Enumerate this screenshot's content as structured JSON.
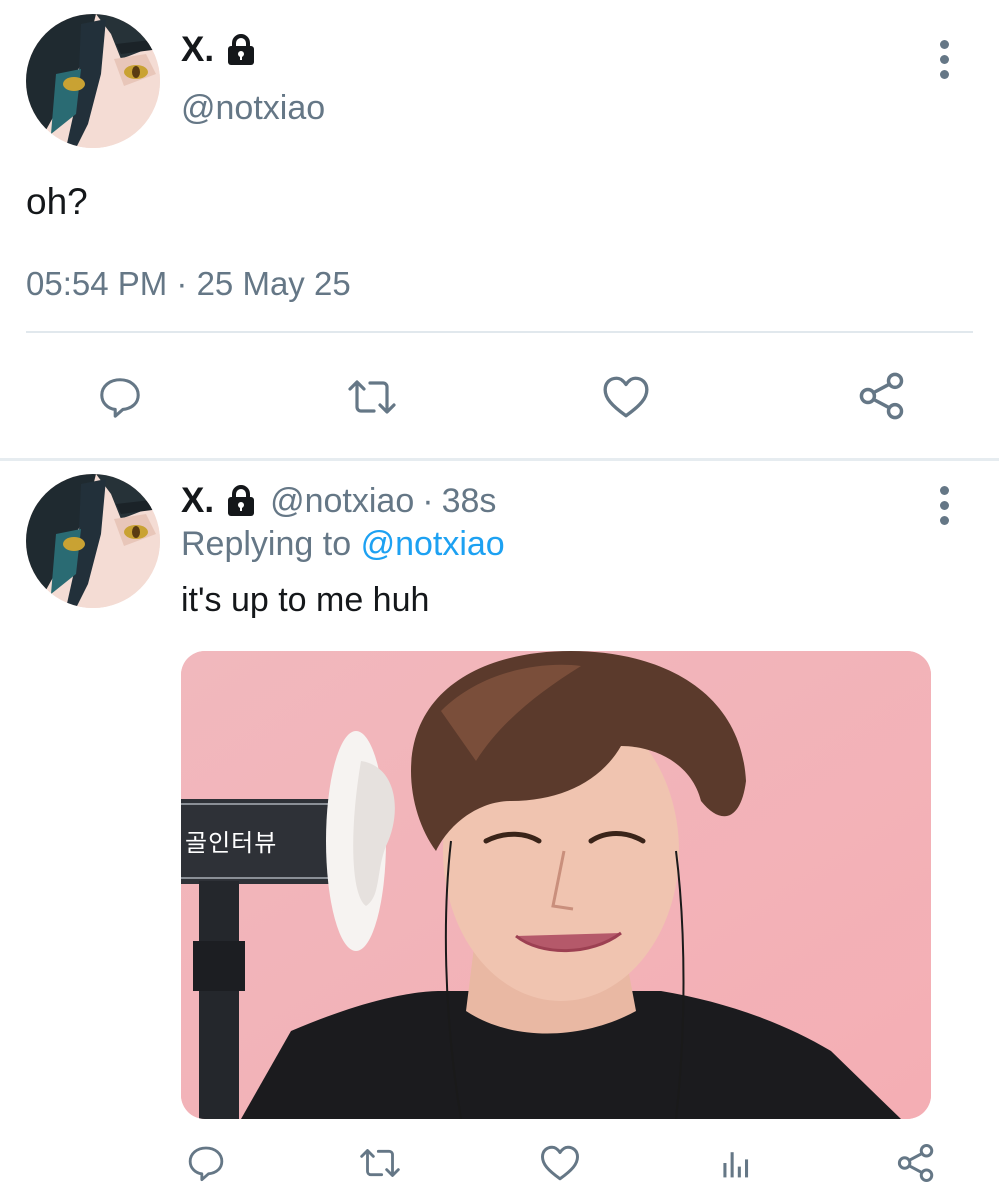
{
  "main_tweet": {
    "display_name": "X.",
    "handle": "@notxiao",
    "text": "oh?",
    "timestamp": "05:54 PM · 25 May 25",
    "avatar": "avatar-image",
    "protected_icon": "lock-icon",
    "actions": [
      "reply-icon",
      "retweet-icon",
      "like-icon",
      "share-icon"
    ],
    "menu_icon": "more-vertical-icon"
  },
  "reply_tweet": {
    "display_name": "X.",
    "handle": "@notxiao",
    "time_ago": "38s",
    "replying_prefix": "Replying to",
    "replying_handle": "@notxiao",
    "text": "it's up to me huh",
    "media_caption": "골인터뷰",
    "avatar": "avatar-image",
    "protected_icon": "lock-icon",
    "actions": [
      "reply-icon",
      "retweet-icon",
      "like-icon",
      "analytics-icon",
      "share-icon"
    ],
    "menu_icon": "more-vertical-icon"
  },
  "colors": {
    "text": "#14171a",
    "muted": "#657786",
    "link": "#1da1f2",
    "divider": "#e1e8ed"
  }
}
